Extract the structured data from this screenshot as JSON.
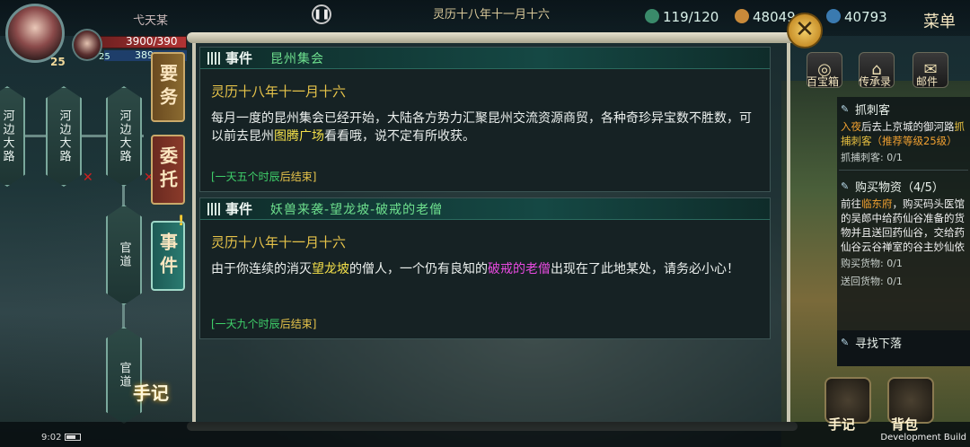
{
  "player": {
    "name": "弋天某",
    "level": "25",
    "hp": "3900/390",
    "mp": "389",
    "companion_level": "25"
  },
  "header": {
    "date_banner": "灵历十八年十一月十六",
    "stamina": "119/120",
    "copper": "48049",
    "silver": "40793",
    "menu": "菜单"
  },
  "route_nodes": [
    "河边大路",
    "河边大路",
    "河边大路",
    "官道",
    "官道"
  ],
  "tabs": {
    "yaowu": "要务",
    "weituo": "委托",
    "shijian": "事件",
    "shouji": "手记"
  },
  "events": [
    {
      "kind": "事件",
      "title": "昆州集会",
      "date": "灵历十八年十一月十六",
      "text_a": "每月一度的昆州集会已经开始，大陆各方势力汇聚昆州交流资源商贸，各种奇珍异宝数不胜数，可以前去昆州",
      "text_hl": "图腾广场",
      "text_b": "看看哦，说不定有所收获。",
      "foot_a": "[一天五个时辰",
      "foot_b": "后结束]"
    },
    {
      "kind": "事件",
      "title": "妖兽来袭-望龙坡-破戒的老僧",
      "date": "灵历十八年十一月十六",
      "text_a": "由于你连续的消灭",
      "text_hl": "望龙坡",
      "text_b": "的僧人，一个仍有良知的",
      "text_hl2": "破戒的老僧",
      "text_c": "出现在了此地某处，请务必小心！",
      "foot_a": "[一天九个时辰",
      "foot_b": "后结束]"
    }
  ],
  "quick_icons": [
    "百宝箱",
    "传承录",
    "邮件"
  ],
  "quests": [
    {
      "title": "抓刺客",
      "desc_a": "入夜",
      "desc_b": "后去上京城的御河路",
      "desc_hl": "抓捕刺客",
      "desc_c": "（推荐等级25级）",
      "progress": [
        "抓捕刺客: 0/1"
      ]
    },
    {
      "title": "购买物资（4/5）",
      "desc_a": "前往",
      "desc_hl": "临东府",
      "desc_b": "，购买码头医馆的吴郎中给药仙谷准备的货物并且送回药仙谷，交给药仙谷云谷禅室的谷主妙仙依",
      "progress": [
        "购买货物: 0/1",
        "送回货物: 0/1"
      ]
    },
    {
      "title": "寻找下落"
    }
  ],
  "bottom": {
    "btn_shouji": "手记",
    "btn_beibao": "背包",
    "clock": "9:02",
    "dev": "Development Build"
  }
}
